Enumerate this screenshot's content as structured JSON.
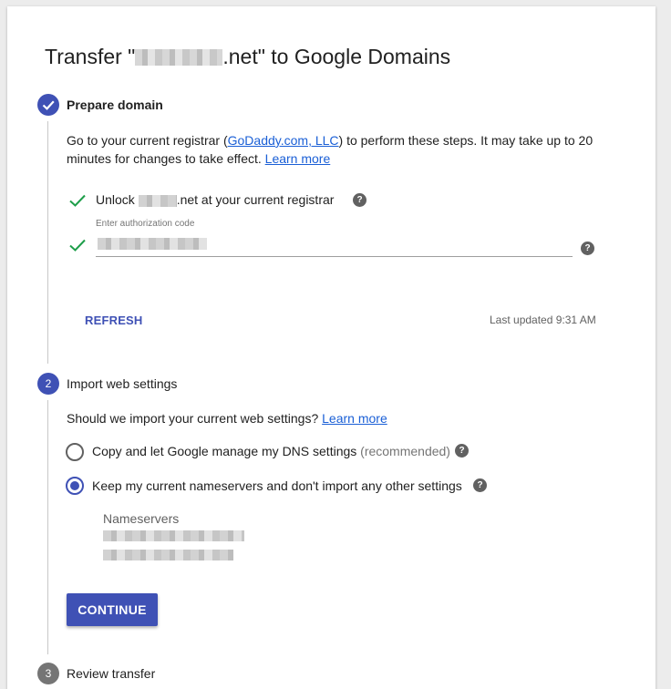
{
  "page": {
    "title_prefix": "Transfer \"",
    "title_suffix": ".net\" to Google Domains"
  },
  "step1": {
    "title": "Prepare domain",
    "intro_prefix": "Go to your current registrar (",
    "registrar_link": "GoDaddy.com, LLC",
    "intro_middle": ") to perform these steps. It may take up to 20 minutes for changes to take effect.",
    "learn_more": "Learn more",
    "unlock_prefix": "Unlock",
    "unlock_suffix": ".net at your current registrar",
    "auth_label": "Enter authorization code",
    "refresh": "REFRESH",
    "last_updated": "Last updated 9:31 AM"
  },
  "step2": {
    "number": "2",
    "title": "Import web settings",
    "question": "Should we import your current web settings?",
    "learn_more": "Learn more",
    "option1": "Copy and let Google manage my DNS settings",
    "option1_note": "(recommended)",
    "option2": "Keep my current nameservers and don't import any other settings",
    "selected_option": "option2",
    "nameservers_label": "Nameservers",
    "continue": "CONTINUE"
  },
  "step3": {
    "number": "3",
    "title": "Review transfer"
  },
  "icons": {
    "step_done": "check-icon",
    "status_ok": "green-check-icon",
    "help": "help-icon"
  },
  "colors": {
    "primary": "#3f51b5",
    "success": "#1e9e4a",
    "link": "#1a5fd6"
  }
}
